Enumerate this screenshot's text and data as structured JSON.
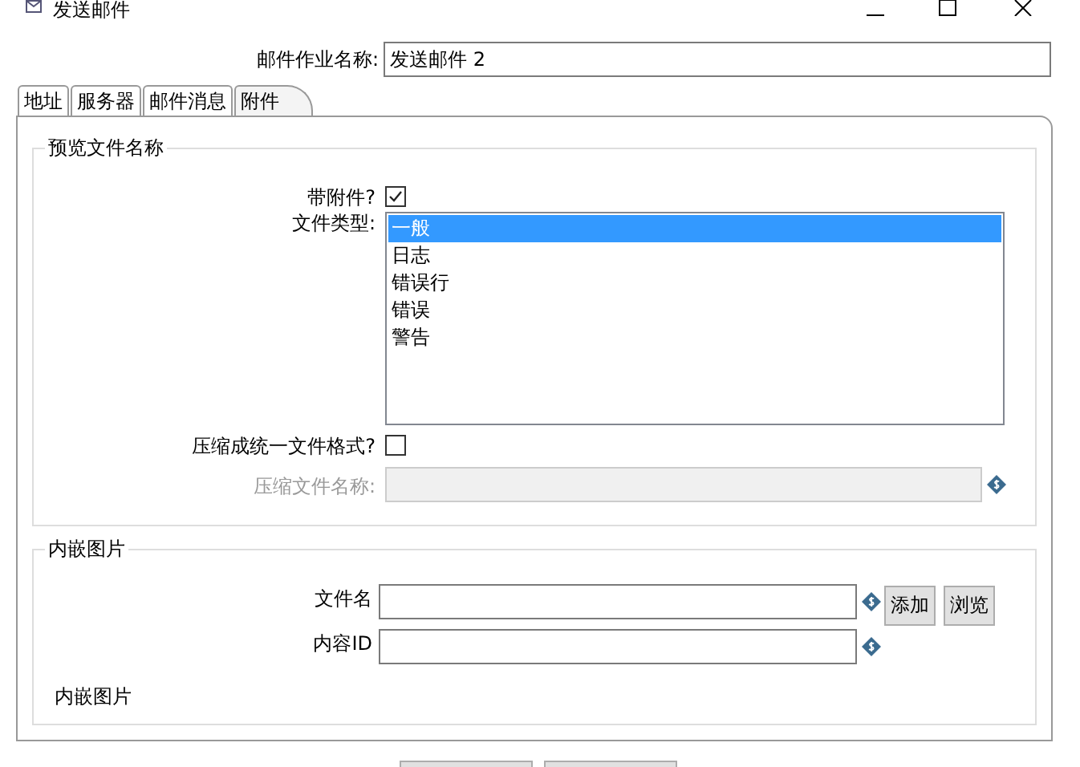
{
  "window": {
    "title": "发送邮件"
  },
  "job_name": {
    "label": "邮件作业名称:",
    "value": "发送邮件 2"
  },
  "tabs": [
    {
      "label": "地址",
      "selected": false
    },
    {
      "label": "服务器",
      "selected": false
    },
    {
      "label": "邮件消息",
      "selected": false
    },
    {
      "label": "附件",
      "selected": true
    }
  ],
  "preview_group": {
    "title": "预览文件名称",
    "attach": {
      "label": "带附件?",
      "checked": true
    },
    "file_type": {
      "label": "文件类型:",
      "items": [
        {
          "label": "一般",
          "selected": true
        },
        {
          "label": "日志",
          "selected": false
        },
        {
          "label": "错误行",
          "selected": false
        },
        {
          "label": "错误",
          "selected": false
        },
        {
          "label": "警告",
          "selected": false
        }
      ]
    },
    "zip": {
      "label": "压缩成统一文件格式?",
      "checked": false
    },
    "zip_name": {
      "label": "压缩文件名称:",
      "disabled": true
    }
  },
  "image_group": {
    "title": "内嵌图片",
    "fields": [
      {
        "label": "文件名",
        "buttons": [
          "添加",
          "浏览"
        ]
      },
      {
        "label": "内容ID"
      }
    ],
    "footer": "内嵌图片"
  }
}
